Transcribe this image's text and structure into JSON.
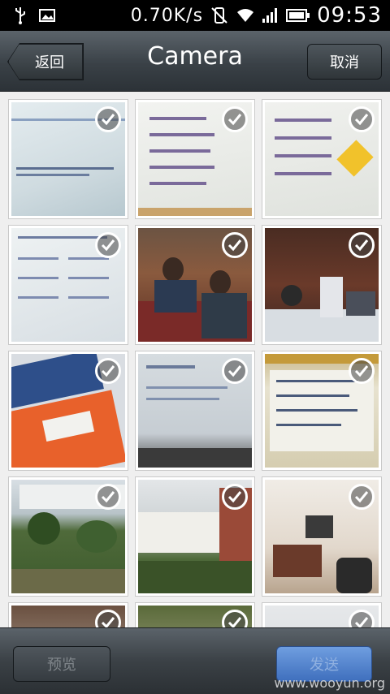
{
  "status_bar": {
    "network_speed": "0.70K/s",
    "time": "09:53",
    "icons": [
      "usb-icon",
      "image-icon",
      "vibrate-off-icon",
      "wifi-icon",
      "signal-icon",
      "battery-icon"
    ]
  },
  "header": {
    "back_label": "返回",
    "title": "Camera",
    "cancel_label": "取消"
  },
  "grid": {
    "thumbnails": [
      {
        "subject": "screenshot-blue"
      },
      {
        "subject": "slide-list"
      },
      {
        "subject": "slide-warning"
      },
      {
        "subject": "slide-text"
      },
      {
        "subject": "people-sofa"
      },
      {
        "subject": "people-room"
      },
      {
        "subject": "book-orange"
      },
      {
        "subject": "projection-screen"
      },
      {
        "subject": "whiteboard"
      },
      {
        "subject": "garden"
      },
      {
        "subject": "building"
      },
      {
        "subject": "hotel-room"
      },
      {
        "subject": "partial"
      },
      {
        "subject": "partial"
      },
      {
        "subject": "partial"
      }
    ],
    "all_selected": true
  },
  "footer": {
    "preview_label": "预览",
    "send_label": "发送",
    "watermark": "www.wooyun.org"
  },
  "colors": {
    "accent_blue": "#4a7bc8",
    "bar_dark": "#3a4147"
  }
}
